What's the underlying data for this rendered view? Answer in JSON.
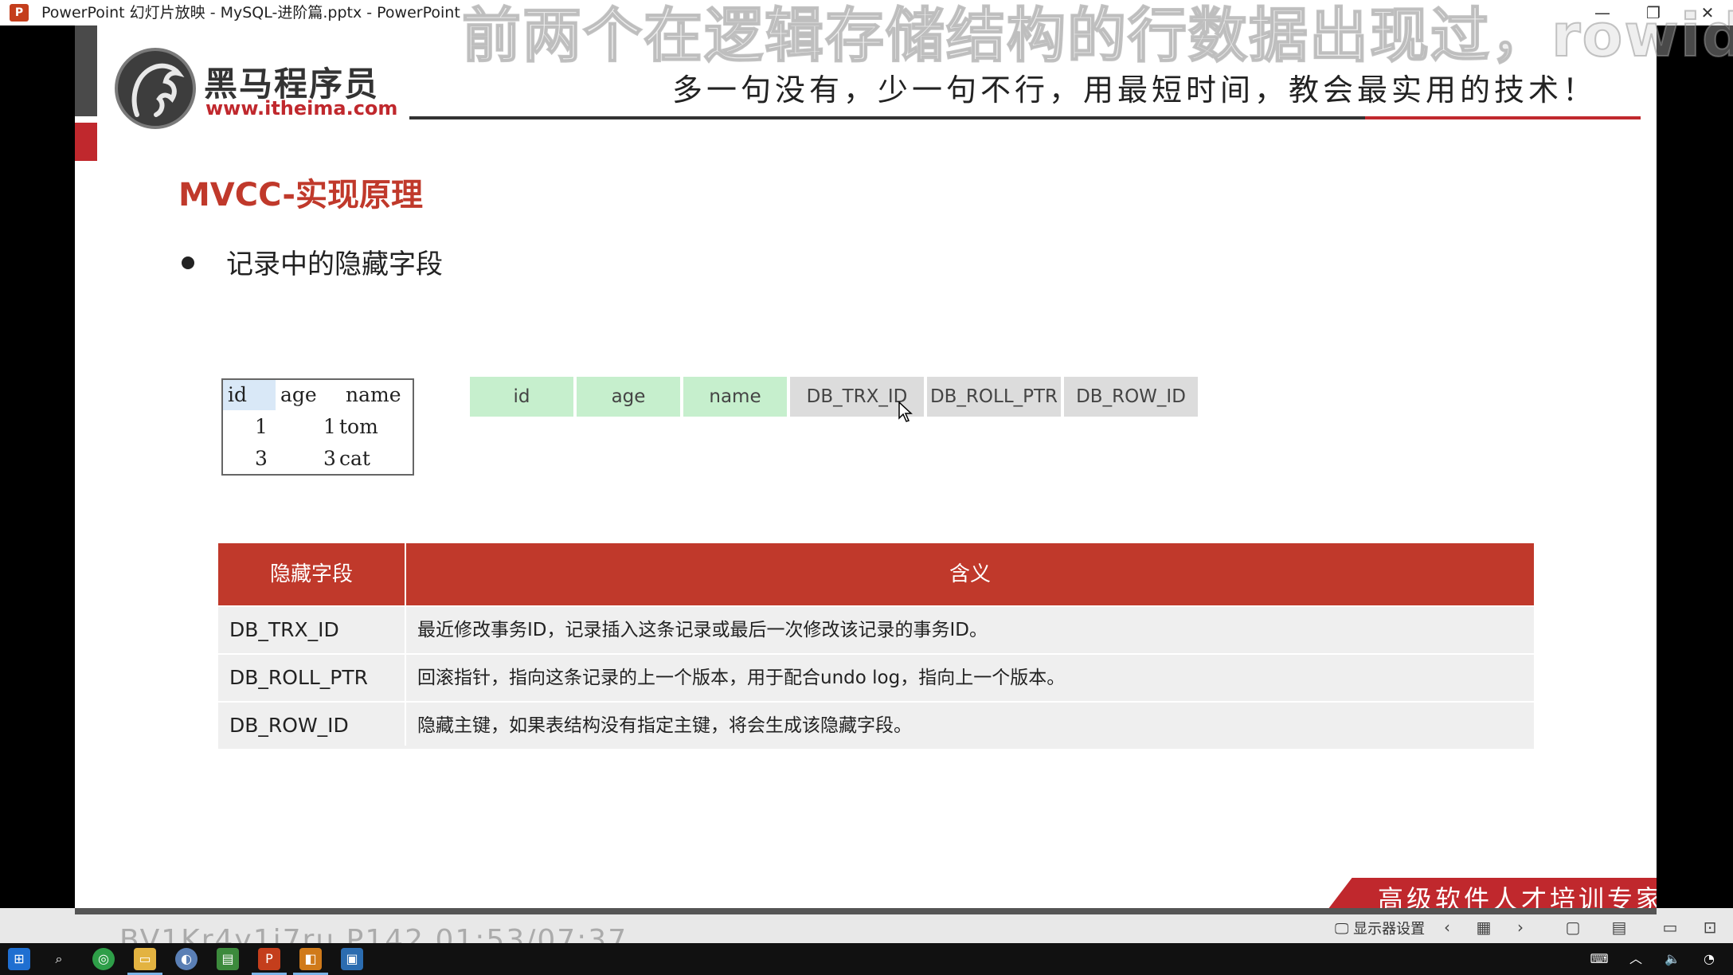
{
  "window": {
    "title": "PowerPoint 幻灯片放映  -  MySQL-进阶篇.pptx - PowerPoint",
    "app_icon": "P",
    "minimize": "—",
    "restore": "❐",
    "close": "✕"
  },
  "overlay_subtitle": "前两个在逻辑存储结构的行数据出现过，rowid在索引没",
  "slide": {
    "logo_text": "黑马程序员",
    "logo_url": "www.itheima.com",
    "slogan": "多一句没有，少一句不行，用最短时间，教会最实用的技术！",
    "title": "MVCC-实现原理",
    "bullet": "记录中的隐藏字段",
    "record_table": {
      "headers": [
        "id",
        "age",
        "name"
      ],
      "rows": [
        {
          "id": "1",
          "age": "1",
          "name": "tom"
        },
        {
          "id": "3",
          "age": "3",
          "name": "cat"
        }
      ]
    },
    "fields": [
      "id",
      "age",
      "name",
      "DB_TRX_ID",
      "DB_ROLL_PTR",
      "DB_ROW_ID"
    ],
    "meaning_table": {
      "headers": [
        "隐藏字段",
        "含义"
      ],
      "rows": [
        {
          "field": "DB_TRX_ID",
          "meaning": "最近修改事务ID，记录插入这条记录或最后一次修改该记录的事务ID。"
        },
        {
          "field": "DB_ROLL_PTR",
          "meaning": "回滚指针，指向这条记录的上一个版本，用于配合undo log，指向上一个版本。"
        },
        {
          "field": "DB_ROW_ID",
          "meaning": "隐藏主键，如果表结构没有指定主键，将会生成该隐藏字段。"
        }
      ]
    },
    "ribbon": "高级软件人才培训专家"
  },
  "presenter_bar": {
    "monitor_label": "显示器设置",
    "prev": "‹",
    "grid": "▦",
    "next": "›"
  },
  "watermark": "BV1Kr4y1i7ru P142 01:53/07:37",
  "colors": {
    "accent_red": "#c0392b",
    "field_green": "#c6efcd",
    "field_gray": "#dcdcdc"
  }
}
